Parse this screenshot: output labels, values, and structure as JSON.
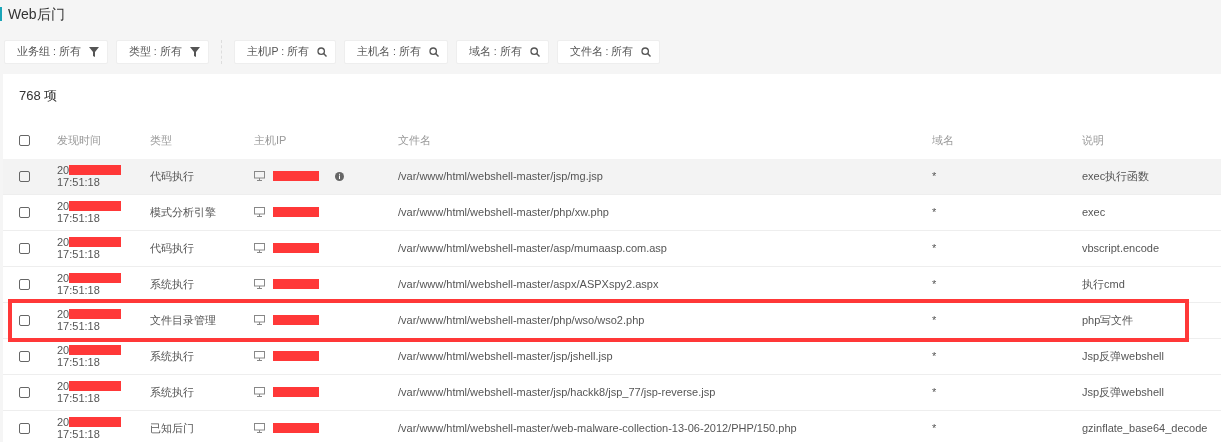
{
  "page_title": "Web后门",
  "filters": [
    {
      "label": "业务组 : 所有",
      "kind": "filter"
    },
    {
      "label": "类型 : 所有",
      "kind": "filter"
    },
    {
      "label": "主机IP : 所有",
      "kind": "search"
    },
    {
      "label": "主机名 : 所有",
      "kind": "search"
    },
    {
      "label": "域名 : 所有",
      "kind": "search"
    },
    {
      "label": "文件名 : 所有",
      "kind": "search"
    }
  ],
  "count": "768 项",
  "table": {
    "select_all_checked": false,
    "columns": [
      "发现时间",
      "类型",
      "主机IP",
      "文件名",
      "域名",
      "说明"
    ],
    "rows": [
      {
        "checked": false,
        "hovered": true,
        "annotated": false,
        "date": "20",
        "time": "17:51:18",
        "type": "代码执行",
        "file": "/var/www/html/webshell-master/jsp/mg.jsp",
        "domain": "*",
        "description": "exec执行函数"
      },
      {
        "checked": false,
        "hovered": false,
        "annotated": false,
        "date": "20",
        "time": "17:51:18",
        "type": "模式分析引擎",
        "file": "/var/www/html/webshell-master/php/xw.php",
        "domain": "*",
        "description": "exec"
      },
      {
        "checked": false,
        "hovered": false,
        "annotated": false,
        "date": "20",
        "time": "17:51:18",
        "type": "代码执行",
        "file": "/var/www/html/webshell-master/asp/mumaasp.com.asp",
        "domain": "*",
        "description": "vbscript.encode"
      },
      {
        "checked": false,
        "hovered": false,
        "annotated": false,
        "date": "20",
        "time": "17:51:18",
        "type": "系统执行",
        "file": "/var/www/html/webshell-master/aspx/ASPXspy2.aspx",
        "domain": "*",
        "description": "执行cmd"
      },
      {
        "checked": false,
        "hovered": false,
        "annotated": true,
        "date": "20",
        "time": "17:51:18",
        "type": "文件目录管理",
        "file": "/var/www/html/webshell-master/php/wso/wso2.php",
        "domain": "*",
        "description": "php写文件"
      },
      {
        "checked": false,
        "hovered": false,
        "annotated": false,
        "date": "20",
        "time": "17:51:18",
        "type": "系统执行",
        "file": "/var/www/html/webshell-master/jsp/jshell.jsp",
        "domain": "*",
        "description": "Jsp反弹webshell"
      },
      {
        "checked": false,
        "hovered": false,
        "annotated": false,
        "date": "20",
        "time": "17:51:18",
        "type": "系统执行",
        "file": "/var/www/html/webshell-master/jsp/hackk8/jsp_77/jsp-reverse.jsp",
        "domain": "*",
        "description": "Jsp反弹webshell"
      },
      {
        "checked": false,
        "hovered": false,
        "annotated": false,
        "date": "20",
        "time": "17:51:18",
        "type": "已知后门",
        "file": "/var/www/html/webshell-master/web-malware-collection-13-06-2012/PHP/150.php",
        "domain": "*",
        "description": "gzinflate_base64_decode"
      }
    ]
  }
}
